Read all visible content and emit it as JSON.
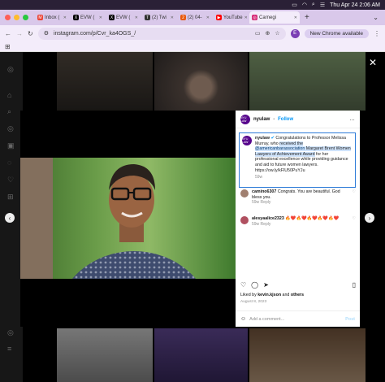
{
  "menubar": {
    "datetime": "Thu Apr 24  2:06 AM"
  },
  "tabs": [
    {
      "label": "Inbox (",
      "fav": "M",
      "color": "#ea4335"
    },
    {
      "label": "EVW (",
      "fav": "X",
      "color": "#000000"
    },
    {
      "label": "EVW (",
      "fav": "X",
      "color": "#000000"
    },
    {
      "label": "(2) Twi",
      "fav": "T",
      "color": "#333333"
    },
    {
      "label": "(2) 04-",
      "fav": "2",
      "color": "#e8590c"
    },
    {
      "label": "YouTube",
      "fav": "▶",
      "color": "#ff0000"
    },
    {
      "label": "Carnegi",
      "fav": "◎",
      "color": "#d62976",
      "active": true
    }
  ],
  "toolbar": {
    "url": "instagram.com/p/Cvr_ka4OGS_/",
    "profile_letter": "E",
    "new_chrome_label": "New Chrome available"
  },
  "post": {
    "username": "nyulaw",
    "follow_label": "Follow",
    "logo_text": "NYU LAW",
    "caption_prefix": "Congratulations to Professor Melissa Murray, who ",
    "caption_hl1": "received the",
    "caption_mention": "@americanbarassociation",
    "caption_hl2": " Margaret Brent Women Lawyers of Achievement Award",
    "caption_suffix": " for her professional excellence while providing guidance and aid to future women lawyers. https://ow.ly/kFlU50PuYJu",
    "caption_time": "59w",
    "comments": [
      {
        "user": "camino6307",
        "text": "Congrats. You are beautiful. God bless you.",
        "meta": "59w   Reply",
        "color": "#a08070"
      },
      {
        "user": "alesyaalice2323",
        "text": "🔥❤️🔥❤️🔥❤️🔥❤️🔥❤️",
        "meta": "59w   Reply",
        "color": "#b05060"
      }
    ],
    "liked_by_prefix": "Liked by ",
    "liked_by_user": "kevin.kjson",
    "liked_by_and": " and ",
    "liked_by_others": "others",
    "date": "August 8, 2023",
    "add_comment_placeholder": "Add a comment...",
    "post_label": "Post"
  },
  "icons": {
    "close": "close-icon",
    "prev": "chevron-left-icon",
    "next": "chevron-right-icon",
    "heart": "heart-icon",
    "comment": "comment-icon",
    "share": "share-icon",
    "save": "bookmark-icon"
  }
}
